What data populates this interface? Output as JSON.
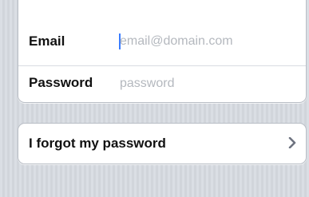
{
  "login_form": {
    "email": {
      "label": "Email",
      "value": "",
      "placeholder": "email@domain.com"
    },
    "password": {
      "label": "Password",
      "value": "",
      "placeholder": "password"
    }
  },
  "forgot": {
    "label": "I forgot my password",
    "icon": "chevron-right-icon"
  },
  "colors": {
    "background": "#d8dce2",
    "group_background": "#ffffff",
    "border": "#b9bec6",
    "placeholder": "#b4b8be",
    "caret": "#3a7cff"
  }
}
